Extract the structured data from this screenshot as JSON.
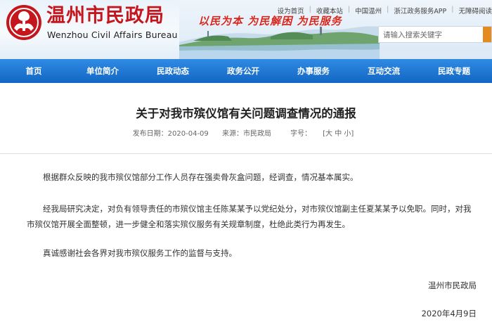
{
  "header": {
    "site_name": "温州市民政局",
    "site_name_en": "Wenzhou Civil Affairs Bureau",
    "slogan": "以民为本  为民解困  为民服务",
    "top_links": [
      "设为首页",
      "收藏本站",
      "中国温州",
      "浙江政务服务APP",
      "无障碍阅读"
    ],
    "search_placeholder": "请输入搜索关键字",
    "colors": {
      "brand_red": "#c4161c",
      "nav_blue": "#1466c4",
      "search_button": "#e58a1f"
    }
  },
  "nav": {
    "items": [
      "首页",
      "单位简介",
      "民政动态",
      "政务公开",
      "办事服务",
      "互动交流",
      "民政专题"
    ]
  },
  "article": {
    "title": "关于对我市殡仪馆有关问题调查情况的通报",
    "publish_date": "发布日期：2020-04-09",
    "source": "来源：市民政局",
    "font_size_label": "字号：",
    "font_size_options": "[大 中 小]",
    "paragraphs": [
      "根据群众反映的我市殡仪馆部分工作人员存在强卖骨灰盒问题，经调查，情况基本属实。",
      "经我局研究决定，对负有领导责任的市殡仪馆主任陈某某予以党纪处分，对市殡仪馆副主任夏某某予以免职。同时，对我市殡仪馆开展全面整顿，进一步健全和落实殡仪服务有关规章制度，杜绝此类行为再发生。",
      "真诚感谢社会各界对我市殡仪服务工作的监督与支持。"
    ],
    "signature": "温州市民政局",
    "date": "2020年4月9日"
  }
}
